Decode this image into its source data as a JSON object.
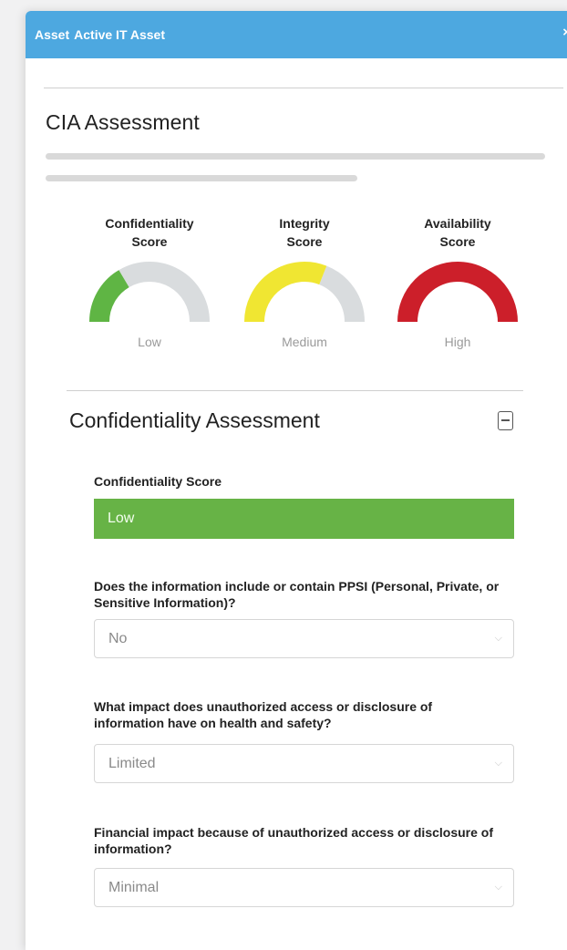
{
  "window": {
    "title_prefix": "Asset",
    "title_main": "Active IT Asset",
    "close_glyph": "×"
  },
  "assessment": {
    "title": "CIA Assessment"
  },
  "gauges": [
    {
      "label_line1": "Confidentiality",
      "label_line2": "Score",
      "value": "Low",
      "fill_fraction": 0.33,
      "color": "#5fb544"
    },
    {
      "label_line1": "Integrity",
      "label_line2": "Score",
      "value": "Medium",
      "fill_fraction": 0.62,
      "color": "#f0e632"
    },
    {
      "label_line1": "Availability",
      "label_line2": "Score",
      "value": "High",
      "fill_fraction": 1.0,
      "color": "#cc1f2a"
    }
  ],
  "gauge_track_color": "#d9dcde",
  "confidentiality": {
    "title": "Confidentiality Assessment",
    "score_label": "Confidentiality Score",
    "score_value": "Low",
    "score_color": "#67b346",
    "questions": [
      {
        "text": "Does the information include or contain PPSI (Personal, Private, or Sensitive Information)?",
        "value": "No"
      },
      {
        "text": "What impact does unauthorized access or disclosure of information have on health and safety?",
        "value": "Limited"
      },
      {
        "text": "Financial impact because of unauthorized access or disclosure of information?",
        "value": "Minimal"
      }
    ]
  },
  "icons": {
    "collapse": "minus-square-icon",
    "close": "close-icon",
    "dropdown": "chevron-down-icon"
  },
  "colors": {
    "header": "#4da8e0",
    "score_low": "#67b346"
  }
}
